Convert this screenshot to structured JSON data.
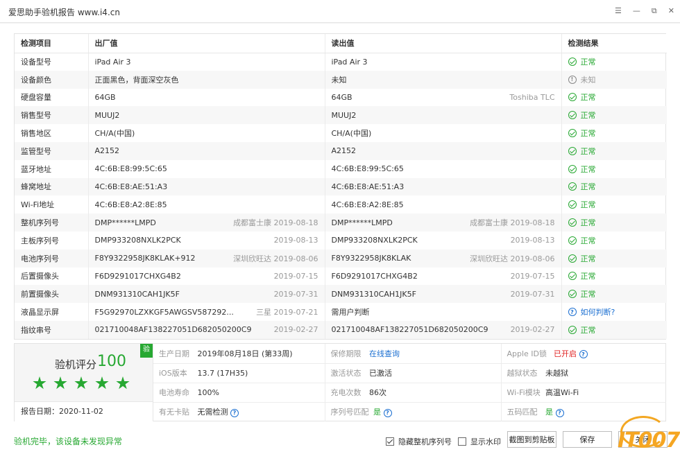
{
  "window": {
    "title": "爱思助手验机报告 www.i4.cn",
    "controls": [
      "☰",
      "—",
      "⧉",
      "✕"
    ]
  },
  "table": {
    "headers": [
      "检测项目",
      "出厂值",
      "读出值",
      "检测结果"
    ],
    "rows": [
      {
        "item": "设备型号",
        "factory": "iPad Air 3",
        "factory_sub": "",
        "read": "iPad Air 3",
        "read_sub": "",
        "result": "正常",
        "status": "ok"
      },
      {
        "item": "设备颜色",
        "factory": "正面黑色，背面深空灰色",
        "factory_sub": "",
        "read": "未知",
        "read_sub": "",
        "result": "未知",
        "status": "unknown"
      },
      {
        "item": "硬盘容量",
        "factory": "64GB",
        "factory_sub": "",
        "read": "64GB",
        "read_sub": "Toshiba TLC",
        "result": "正常",
        "status": "ok"
      },
      {
        "item": "销售型号",
        "factory": "MUUJ2",
        "factory_sub": "",
        "read": "MUUJ2",
        "read_sub": "",
        "result": "正常",
        "status": "ok"
      },
      {
        "item": "销售地区",
        "factory": "CH/A(中国)",
        "factory_sub": "",
        "read": "CH/A(中国)",
        "read_sub": "",
        "result": "正常",
        "status": "ok"
      },
      {
        "item": "监管型号",
        "factory": "A2152",
        "factory_sub": "",
        "read": "A2152",
        "read_sub": "",
        "result": "正常",
        "status": "ok"
      },
      {
        "item": "蓝牙地址",
        "factory": "4C:6B:E8:99:5C:65",
        "factory_sub": "",
        "read": "4C:6B:E8:99:5C:65",
        "read_sub": "",
        "result": "正常",
        "status": "ok"
      },
      {
        "item": "蜂窝地址",
        "factory": "4C:6B:E8:AE:51:A3",
        "factory_sub": "",
        "read": "4C:6B:E8:AE:51:A3",
        "read_sub": "",
        "result": "正常",
        "status": "ok"
      },
      {
        "item": "Wi-Fi地址",
        "factory": "4C:6B:E8:A2:8E:85",
        "factory_sub": "",
        "read": "4C:6B:E8:A2:8E:85",
        "read_sub": "",
        "result": "正常",
        "status": "ok"
      },
      {
        "item": "整机序列号",
        "factory": "DMP******LMPD",
        "factory_sub": "成都富士康 2019-08-18",
        "read": "DMP******LMPD",
        "read_sub": "成都富士康 2019-08-18",
        "result": "正常",
        "status": "ok"
      },
      {
        "item": "主板序列号",
        "factory": "DMP933208NXLK2PCK",
        "factory_sub": "2019-08-13",
        "read": "DMP933208NXLK2PCK",
        "read_sub": "2019-08-13",
        "result": "正常",
        "status": "ok"
      },
      {
        "item": "电池序列号",
        "factory": "F8Y9322958JK8KLAK+912",
        "factory_sub": "深圳欣旺达 2019-08-06",
        "read": "F8Y9322958JK8KLAK",
        "read_sub": "深圳欣旺达 2019-08-06",
        "result": "正常",
        "status": "ok"
      },
      {
        "item": "后置摄像头",
        "factory": "F6D9291017CHXG4B2",
        "factory_sub": "2019-07-15",
        "read": "F6D9291017CHXG4B2",
        "read_sub": "2019-07-15",
        "result": "正常",
        "status": "ok"
      },
      {
        "item": "前置摄像头",
        "factory": "DNM931310CAH1JK5F",
        "factory_sub": "2019-07-31",
        "read": "DNM931310CAH1JK5F",
        "read_sub": "2019-07-31",
        "result": "正常",
        "status": "ok"
      },
      {
        "item": "液晶显示屏",
        "factory": "F5G92970LZXKGF5AWGSV587292...",
        "factory_sub": "三星 2019-07-21",
        "read": "需用户判断",
        "read_sub": "",
        "result": "如何判断?",
        "status": "question"
      },
      {
        "item": "指纹串号",
        "factory": "021710048AF138227051D682050200C9",
        "factory_sub": "2019-02-27",
        "read": "021710048AF138227051D682050200C9",
        "read_sub": "2019-02-27",
        "result": "正常",
        "status": "ok"
      }
    ]
  },
  "score": {
    "label": "验机评分",
    "value": "100",
    "badge": "验",
    "stars": 5,
    "report_date": "报告日期：2020-11-02"
  },
  "info": {
    "production_date_label": "生产日期",
    "production_date": "2019年08月18日 (第33周)",
    "warranty_label": "保修期限",
    "warranty": "在线查询",
    "appleid_label": "Apple ID锁",
    "appleid": "已开启",
    "ios_label": "iOS版本",
    "ios": "13.7 (17H35)",
    "activation_label": "激活状态",
    "activation": "已激活",
    "jailbreak_label": "越狱状态",
    "jailbreak": "未越狱",
    "battery_label": "电池寿命",
    "battery": "100%",
    "charge_label": "充电次数",
    "charge": "86次",
    "wifi_label": "Wi-Fi模块",
    "wifi": "高温Wi-Fi",
    "sim_label": "有无卡贴",
    "sim": "无需检测",
    "serial_match_label": "序列号匹配",
    "serial_match": "是",
    "fivecode_label": "五码匹配",
    "fivecode": "是"
  },
  "footer": {
    "message": "验机完毕，该设备未发现异常",
    "hide_serial": "隐藏整机序列号",
    "watermark": "显示水印",
    "screenshot_btn": "截图到剪贴板",
    "save_btn": "保存",
    "close_btn": "关闭",
    "logo_text": "IT007"
  },
  "colors": {
    "ok": "#27a832",
    "link": "#1b6fd1",
    "alert": "#e02020"
  }
}
